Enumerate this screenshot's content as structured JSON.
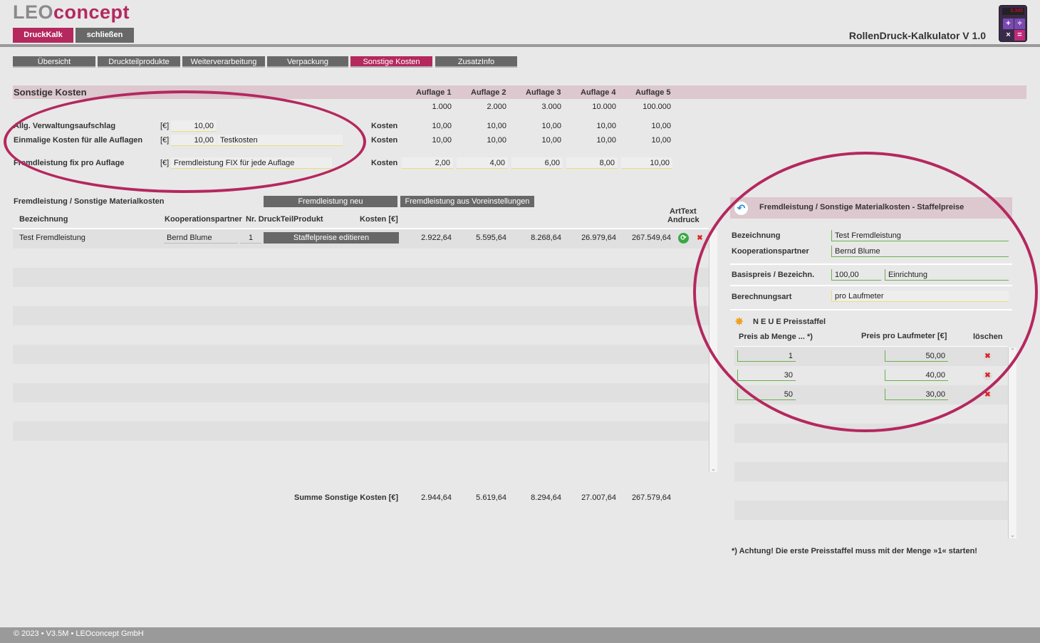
{
  "app": {
    "logo_leo": "LEO",
    "logo_concept": "concept",
    "btn_druckkalk": "DruckKalk",
    "btn_close": "schließen",
    "title": "RollenDruck-Kalkulator V 1.0",
    "calc_display": "0.345"
  },
  "tabs": [
    "Übersicht",
    "Druckteilprodukte",
    "Weiterverarbeitung",
    "Verpackung",
    "Sonstige Kosten",
    "ZusatzInfo"
  ],
  "section": {
    "title": "Sonstige Kosten",
    "auflagen": [
      "Auflage 1",
      "Auflage 2",
      "Auflage 3",
      "Auflage 4",
      "Auflage 5"
    ],
    "quantities": [
      "1.000",
      "2.000",
      "3.000",
      "10.000",
      "100.000"
    ],
    "rows": [
      {
        "label": "Allg. Verwaltungsaufschlag",
        "unit": "[€]",
        "value": "10,00",
        "text": "",
        "kosten": "Kosten",
        "values": [
          "10,00",
          "10,00",
          "10,00",
          "10,00",
          "10,00"
        ]
      },
      {
        "label": "Einmalige Kosten für alle Auflagen",
        "unit": "[€]",
        "value": "10,00",
        "text": "Testkosten",
        "kosten": "Kosten",
        "values": [
          "10,00",
          "10,00",
          "10,00",
          "10,00",
          "10,00"
        ]
      },
      {
        "label": "Fremdleistung fix pro Auflage",
        "unit": "[€]",
        "value": "",
        "text": "Fremdleistung FIX für jede Auflage",
        "kosten": "Kosten",
        "values": [
          "2,00",
          "4,00",
          "6,00",
          "8,00",
          "10,00"
        ]
      }
    ]
  },
  "fremd": {
    "title": "Fremdleistung /  Sonstige Materialkosten",
    "btn_new": "Fremdleistung neu",
    "btn_preset": "Fremdleistung aus Voreinstellungen",
    "headers": {
      "bez": "Bezeichnung",
      "koop": "Kooperationspartner",
      "nr": "Nr. DruckTeilProdukt",
      "kosten": "Kosten [€]",
      "arttext1": "ArtText",
      "arttext2": "Andruck"
    },
    "row": {
      "bez": "Test Fremdleistung",
      "koop": "Bernd Blume",
      "nr": "1",
      "btn": "Staffelpreise editieren",
      "values": [
        "2.922,64",
        "5.595,64",
        "8.268,64",
        "26.979,64",
        "267.549,64"
      ]
    },
    "sum_label": "Summe Sonstige Kosten [€]",
    "sum_values": [
      "2.944,64",
      "5.619,64",
      "8.294,64",
      "27.007,64",
      "267.579,64"
    ]
  },
  "panel": {
    "title": "Fremdleistung /  Sonstige Materialkosten - Staffelpreise",
    "bez_label": "Bezeichnung",
    "bez_value": "Test Fremdleistung",
    "koop_label": "Kooperationspartner",
    "koop_value": "Bernd Blume",
    "basis_label": "Basispreis / Bezeichn.",
    "basis_value": "100,00",
    "basis_text": "Einrichtung",
    "berech_label": "Berechnungsart",
    "berech_value": "pro Laufmeter",
    "neue": "N E U E  Preisstaffel",
    "col_menge": "Preis ab Menge ... *)",
    "col_preis": "Preis pro Laufmeter [€]",
    "col_del": "löschen",
    "staffel": [
      {
        "menge": "1",
        "preis": "50,00"
      },
      {
        "menge": "30",
        "preis": "40,00"
      },
      {
        "menge": "50",
        "preis": "30,00"
      }
    ],
    "note": "*) Achtung! Die erste Preisstaffel muss mit der Menge »1« starten!"
  },
  "footer": "© 2023 • V3.5M • LEOconcept GmbH"
}
